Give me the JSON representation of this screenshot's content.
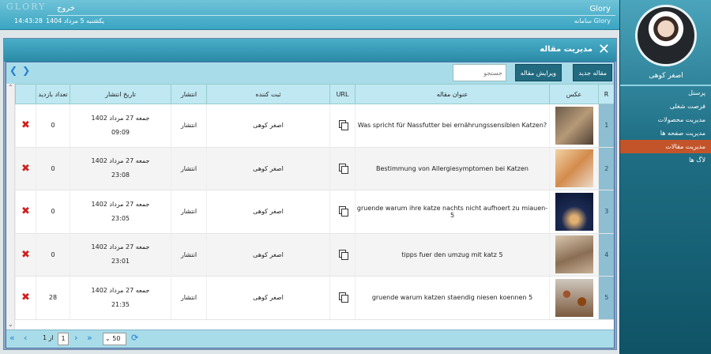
{
  "header": {
    "app_name": "Glory",
    "subtitle": "سامانه Glory",
    "logout_label": "خروج",
    "logo_text": "GLORY",
    "date": "یکشنبه 5 مرداد 1404",
    "time": "14:43:28"
  },
  "sidebar": {
    "username": "اصغر کوهی",
    "items": [
      {
        "label": "پرسنل"
      },
      {
        "label": "فرصت شغلی"
      },
      {
        "label": "مدیریت محصولات"
      },
      {
        "label": "مدیریت صفحه ها"
      },
      {
        "label": "مدیریت مقالات",
        "active": true
      },
      {
        "label": "لاگ ها"
      }
    ]
  },
  "panel": {
    "title": "مدیریت مقاله",
    "new_button": "مقاله جدید",
    "edit_button": "ویرایش مقاله",
    "search_placeholder": "جستجو"
  },
  "table": {
    "headers": {
      "r": "R",
      "image": "عکس",
      "title": "عنوان مقاله",
      "url": "URL",
      "author": "ثبت کننده",
      "publish": "انتشار",
      "date": "تاریخ انتشار",
      "visits": "تعداد بازدید"
    },
    "rows": [
      {
        "r": "1",
        "title": "Was spricht für Nassfutter bei ernährungssensiblen Katzen?",
        "author": "اصغر کوهی",
        "publish": "انتشار",
        "date": "جمعه 27 مرداد 1402",
        "time": "09:09",
        "visits": "0"
      },
      {
        "r": "2",
        "title": "Bestimmung von Allergiesymptomen bei Katzen",
        "author": "اصغر کوهی",
        "publish": "انتشار",
        "date": "جمعه 27 مرداد 1402",
        "time": "23:08",
        "visits": "0"
      },
      {
        "r": "3",
        "title": "gruende warum ihre katze nachts nicht aufhoert zu miauen-5",
        "author": "اصغر کوهی",
        "publish": "انتشار",
        "date": "جمعه 27 مرداد 1402",
        "time": "23:05",
        "visits": "0"
      },
      {
        "r": "4",
        "title": "tipps fuer den umzug mit katz 5",
        "author": "اصغر کوهی",
        "publish": "انتشار",
        "date": "جمعه 27 مرداد 1402",
        "time": "23:01",
        "visits": "0"
      },
      {
        "r": "5",
        "title": "gruende warum katzen staendig niesen koennen 5",
        "author": "اصغر کوهی",
        "publish": "انتشار",
        "date": "جمعه 27 مرداد 1402",
        "time": "21:35",
        "visits": "28"
      }
    ]
  },
  "pager": {
    "page": "1",
    "of_label": "از",
    "total_pages": "1",
    "page_size": "50"
  },
  "colors": {
    "header": "#3aa5c2",
    "sidebar": "#1f6f85",
    "active_menu": "#c3542a",
    "button": "#216a80",
    "delete": "#d01f1f"
  }
}
